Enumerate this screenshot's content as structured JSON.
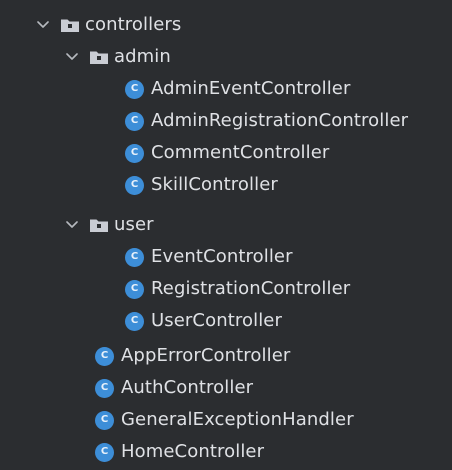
{
  "tree": {
    "root": {
      "label": "controllers",
      "expanded": true
    },
    "admin": {
      "label": "admin",
      "expanded": true,
      "children": [
        {
          "label": "AdminEventController",
          "icon": "class-icon"
        },
        {
          "label": "AdminRegistrationController",
          "icon": "class-icon"
        },
        {
          "label": "CommentController",
          "icon": "class-icon"
        },
        {
          "label": "SkillController",
          "icon": "class-icon"
        }
      ]
    },
    "user": {
      "label": "user",
      "expanded": true,
      "children": [
        {
          "label": "EventController",
          "icon": "class-icon"
        },
        {
          "label": "RegistrationController",
          "icon": "class-icon"
        },
        {
          "label": "UserController",
          "icon": "class-icon"
        }
      ]
    },
    "root_children": [
      {
        "label": "AppErrorController",
        "icon": "class-icon"
      },
      {
        "label": "AuthController",
        "icon": "class-icon"
      },
      {
        "label": "GeneralExceptionHandler",
        "icon": "class-icon"
      },
      {
        "label": "HomeController",
        "icon": "class-icon"
      }
    ],
    "class_icon_letter": "C",
    "colors": {
      "background": "#2b2d30",
      "text": "#dfe1e5",
      "class_icon": "#3d8ed8",
      "folder": "#c9ccd3",
      "chevron": "#b6b9bf"
    }
  }
}
